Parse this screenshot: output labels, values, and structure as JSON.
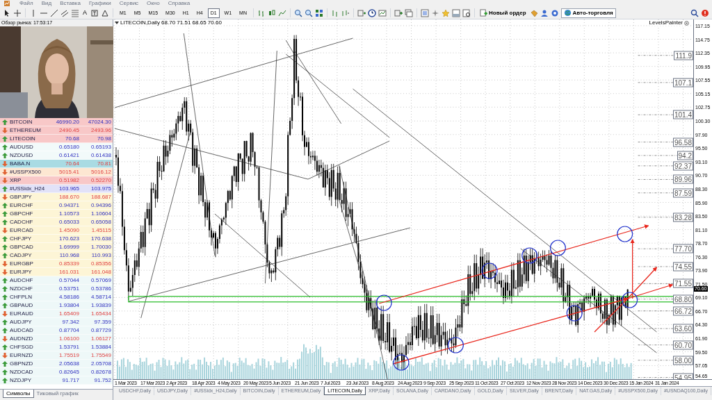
{
  "menu": [
    "Файл",
    "Вид",
    "Вставка",
    "Графики",
    "Сервис",
    "Окно",
    "Справка"
  ],
  "toolbar": {
    "text_tool": "A",
    "timeframes": [
      {
        "label": "M1",
        "selected": false
      },
      {
        "label": "M5",
        "selected": false
      },
      {
        "label": "M15",
        "selected": false
      },
      {
        "label": "M30",
        "selected": false
      },
      {
        "label": "H1",
        "selected": false
      },
      {
        "label": "H4",
        "selected": false
      },
      {
        "label": "D1",
        "selected": true
      },
      {
        "label": "W1",
        "selected": false
      },
      {
        "label": "MN",
        "selected": false
      }
    ],
    "new_order": "Новый ордер",
    "auto_trading": "Авто-торговля"
  },
  "market_watch": {
    "title": "Обзор рынка: 17:53:17",
    "rows": [
      {
        "symbol": "BITCOIN",
        "bid": "46990.20",
        "ask": "47024.30",
        "kind": "up",
        "color": "#f8c8c8"
      },
      {
        "symbol": "ETHEREUM",
        "bid": "2490.45",
        "ask": "2493.96",
        "kind": "down",
        "color": "#f8c8c8"
      },
      {
        "symbol": "LITECOIN",
        "bid": "70.68",
        "ask": "70.98",
        "kind": "up",
        "color": "#f8c8c8"
      },
      {
        "symbol": "AUDUSD",
        "bid": "0.65180",
        "ask": "0.65193",
        "kind": "up",
        "color": "#f2fafa"
      },
      {
        "symbol": "NZDUSD",
        "bid": "0.61421",
        "ask": "0.61438",
        "kind": "up",
        "color": "#f2fafa"
      },
      {
        "symbol": "BABA.N",
        "bid": "70.64",
        "ask": "70.81",
        "kind": "down",
        "color": "#a9dbe3"
      },
      {
        "symbol": "#USSPX500",
        "bid": "5015.41",
        "ask": "5016.12",
        "kind": "down",
        "color": "#fde7d2"
      },
      {
        "symbol": "XRP",
        "bid": "0.51982",
        "ask": "0.52270",
        "kind": "down",
        "color": "#f8c8c8"
      },
      {
        "symbol": "#USSidx_H24",
        "bid": "103.965",
        "ask": "103.975",
        "kind": "up",
        "color": "#e2e2f8"
      },
      {
        "symbol": "GBPJPY",
        "bid": "188.670",
        "ask": "188.687",
        "kind": "down",
        "color": "#fdf5d6"
      },
      {
        "symbol": "EURCHF",
        "bid": "0.94371",
        "ask": "0.94396",
        "kind": "up",
        "color": "#fdf5d6"
      },
      {
        "symbol": "GBPCHF",
        "bid": "1.10573",
        "ask": "1.10604",
        "kind": "up",
        "color": "#fdf5d6"
      },
      {
        "symbol": "CADCHF",
        "bid": "0.65033",
        "ask": "0.65058",
        "kind": "up",
        "color": "#fdf5d6"
      },
      {
        "symbol": "EURCAD",
        "bid": "1.45090",
        "ask": "1.45115",
        "kind": "down",
        "color": "#fdf5d6"
      },
      {
        "symbol": "CHFJPY",
        "bid": "170.623",
        "ask": "170.638",
        "kind": "up",
        "color": "#fdf5d6"
      },
      {
        "symbol": "GBPCAD",
        "bid": "1.69999",
        "ask": "1.70030",
        "kind": "up",
        "color": "#fdf5d6"
      },
      {
        "symbol": "CADJPY",
        "bid": "110.968",
        "ask": "110.993",
        "kind": "up",
        "color": "#fdf5d6"
      },
      {
        "symbol": "EURGBP",
        "bid": "0.85339",
        "ask": "0.85356",
        "kind": "down",
        "color": "#fdf5d6"
      },
      {
        "symbol": "EURJPY",
        "bid": "161.031",
        "ask": "161.048",
        "kind": "down",
        "color": "#fdf5d6"
      },
      {
        "symbol": "AUDCHF",
        "bid": "0.57044",
        "ask": "0.57069",
        "kind": "up",
        "color": "#eef8f8"
      },
      {
        "symbol": "NZDCHF",
        "bid": "0.53751",
        "ask": "0.53786",
        "kind": "up",
        "color": "#eef8f8"
      },
      {
        "symbol": "CHFPLN",
        "bid": "4.58186",
        "ask": "4.58714",
        "kind": "up",
        "color": "#eef8f8"
      },
      {
        "symbol": "GBPAUD",
        "bid": "1.93804",
        "ask": "1.93839",
        "kind": "up",
        "color": "#eef8f8"
      },
      {
        "symbol": "EURAUD",
        "bid": "1.65409",
        "ask": "1.65434",
        "kind": "down",
        "color": "#eef8f8"
      },
      {
        "symbol": "AUDJPY",
        "bid": "97.342",
        "ask": "97.359",
        "kind": "up",
        "color": "#eef8f8"
      },
      {
        "symbol": "AUDCAD",
        "bid": "0.87704",
        "ask": "0.87729",
        "kind": "up",
        "color": "#eef8f8"
      },
      {
        "symbol": "AUDNZD",
        "bid": "1.06100",
        "ask": "1.06127",
        "kind": "down",
        "color": "#eef8f8"
      },
      {
        "symbol": "CHFSGD",
        "bid": "1.53791",
        "ask": "1.53884",
        "kind": "up",
        "color": "#eef8f8"
      },
      {
        "symbol": "EURNZD",
        "bid": "1.75519",
        "ask": "1.75549",
        "kind": "down",
        "color": "#eef8f8"
      },
      {
        "symbol": "GBPNZD",
        "bid": "2.05638",
        "ask": "2.05708",
        "kind": "up",
        "color": "#eef8f8"
      },
      {
        "symbol": "NZDCAD",
        "bid": "0.82645",
        "ask": "0.82678",
        "kind": "up",
        "color": "#eef8f8"
      },
      {
        "symbol": "NZDJPY",
        "bid": "91.717",
        "ask": "91.752",
        "kind": "up",
        "color": "#eef8f8"
      }
    ],
    "tabs": [
      {
        "label": "Символы",
        "selected": true
      },
      {
        "label": "Тиковый график",
        "selected": false
      }
    ]
  },
  "chart": {
    "header": "LITECOIN,Daily 68.70 71.51 68.65 70.60",
    "indicator": "LevelsPainter",
    "price_ticks": [
      "117.15",
      "114.75",
      "112.35",
      "109.95",
      "107.55",
      "105.15",
      "102.75",
      "100.30",
      "97.90",
      "95.50",
      "93.10",
      "90.70",
      "88.30",
      "85.90",
      "83.50",
      "81.10",
      "78.70",
      "76.30",
      "73.90",
      "71.50",
      "69.10",
      "66.70",
      "64.30",
      "61.90",
      "59.50",
      "57.05",
      "54.65"
    ],
    "current_price": "70.60",
    "levels": [
      "111.9",
      "107.1",
      "101.4",
      "96.58",
      "94.2",
      "92.37",
      "89.96",
      "87.59",
      "83.28",
      "77.70",
      "74.55",
      "71.55",
      "68.80",
      "66.72",
      "63.60",
      "60.70",
      "58.00",
      "54.95"
    ],
    "dates": [
      "1 Mar 2023",
      "17 Mar 2023",
      "2 Apr 2023",
      "18 Apr 2023",
      "4 May 2023",
      "20 May 2023",
      "5 Jun 2023",
      "21 Jun 2023",
      "7 Jul 2023",
      "23 Jul 2023",
      "8 Aug 2023",
      "24 Aug 2023",
      "9 Sep 2023",
      "25 Sep 2023",
      "11 Oct 2023",
      "27 Oct 2023",
      "12 Nov 2023",
      "28 Nov 2023",
      "14 Dec 2023",
      "30 Dec 2023",
      "15 Jan 2024",
      "31 Jan 2024"
    ]
  },
  "chart_tabs": [
    {
      "label": "USDCHF,Daily",
      "selected": false
    },
    {
      "label": "USDJPY,Daily",
      "selected": false
    },
    {
      "label": "#USSidx_H24,Daily",
      "selected": false
    },
    {
      "label": "BITCOIN,Daily",
      "selected": false
    },
    {
      "label": "ETHEREUM,Daily",
      "selected": false
    },
    {
      "label": "LITECOIN,Daily",
      "selected": true
    },
    {
      "label": "XRP,Daily",
      "selected": false
    },
    {
      "label": "SOLANA,Daily",
      "selected": false
    },
    {
      "label": "CARDANO,Daily",
      "selected": false
    },
    {
      "label": "GOLD,Daily",
      "selected": false
    },
    {
      "label": "SILVER,Daily",
      "selected": false
    },
    {
      "label": "BRENT,Daily",
      "selected": false
    },
    {
      "label": "NAT.GAS,Daily",
      "selected": false
    },
    {
      "label": "#USSPX500,Daily",
      "selected": false
    },
    {
      "label": "#USNDAQ100,Daily",
      "selected": false
    }
  ]
}
